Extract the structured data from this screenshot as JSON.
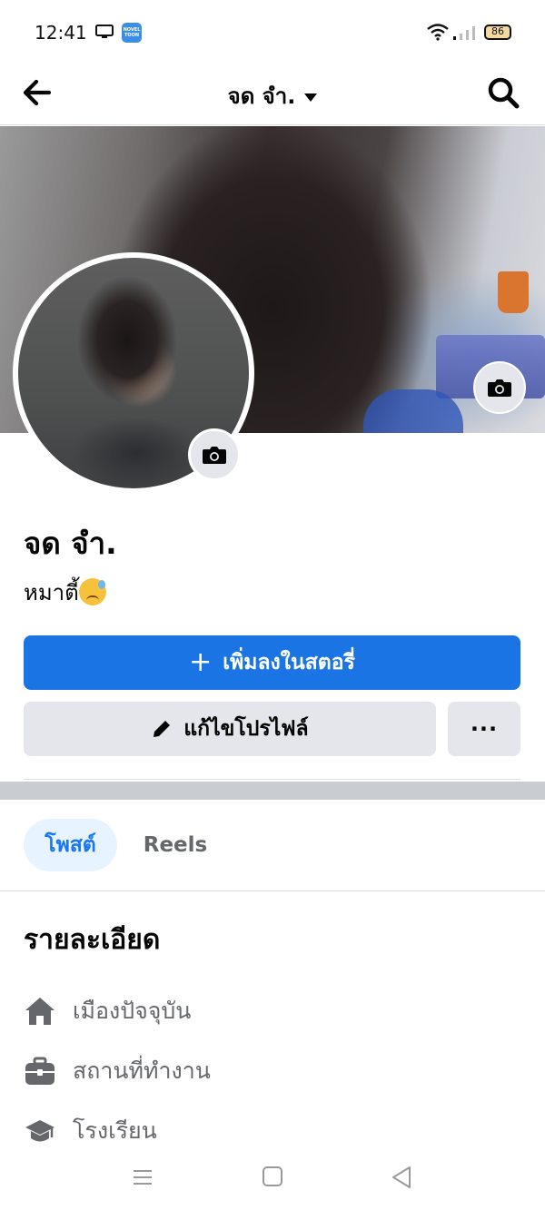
{
  "status_bar": {
    "time": "12:41",
    "app_badge": "NOVEL TOON",
    "battery": "86"
  },
  "header": {
    "title": "จด จำ."
  },
  "profile": {
    "name": "จด จำ.",
    "bio": "หมาตี้"
  },
  "actions": {
    "add_story": "เพิ่มลงในสตอรี่",
    "add_story_plus": "+",
    "edit_profile": "แก้ไขโปรไฟล์",
    "more": "···"
  },
  "tabs": [
    {
      "label": "โพสต์",
      "active": true
    },
    {
      "label": "Reels",
      "active": false
    }
  ],
  "details": {
    "heading": "รายละเอียด",
    "items": [
      {
        "icon": "home-icon",
        "label": "เมืองปัจจุบัน"
      },
      {
        "icon": "briefcase-icon",
        "label": "สถานที่ทำงาน"
      },
      {
        "icon": "graduation-cap-icon",
        "label": "โรงเรียน"
      }
    ]
  },
  "colors": {
    "primary": "#1b74e4",
    "secondary_button": "#e4e6eb",
    "tab_active_bg": "#e7f3ff",
    "muted_text": "#65676b"
  }
}
